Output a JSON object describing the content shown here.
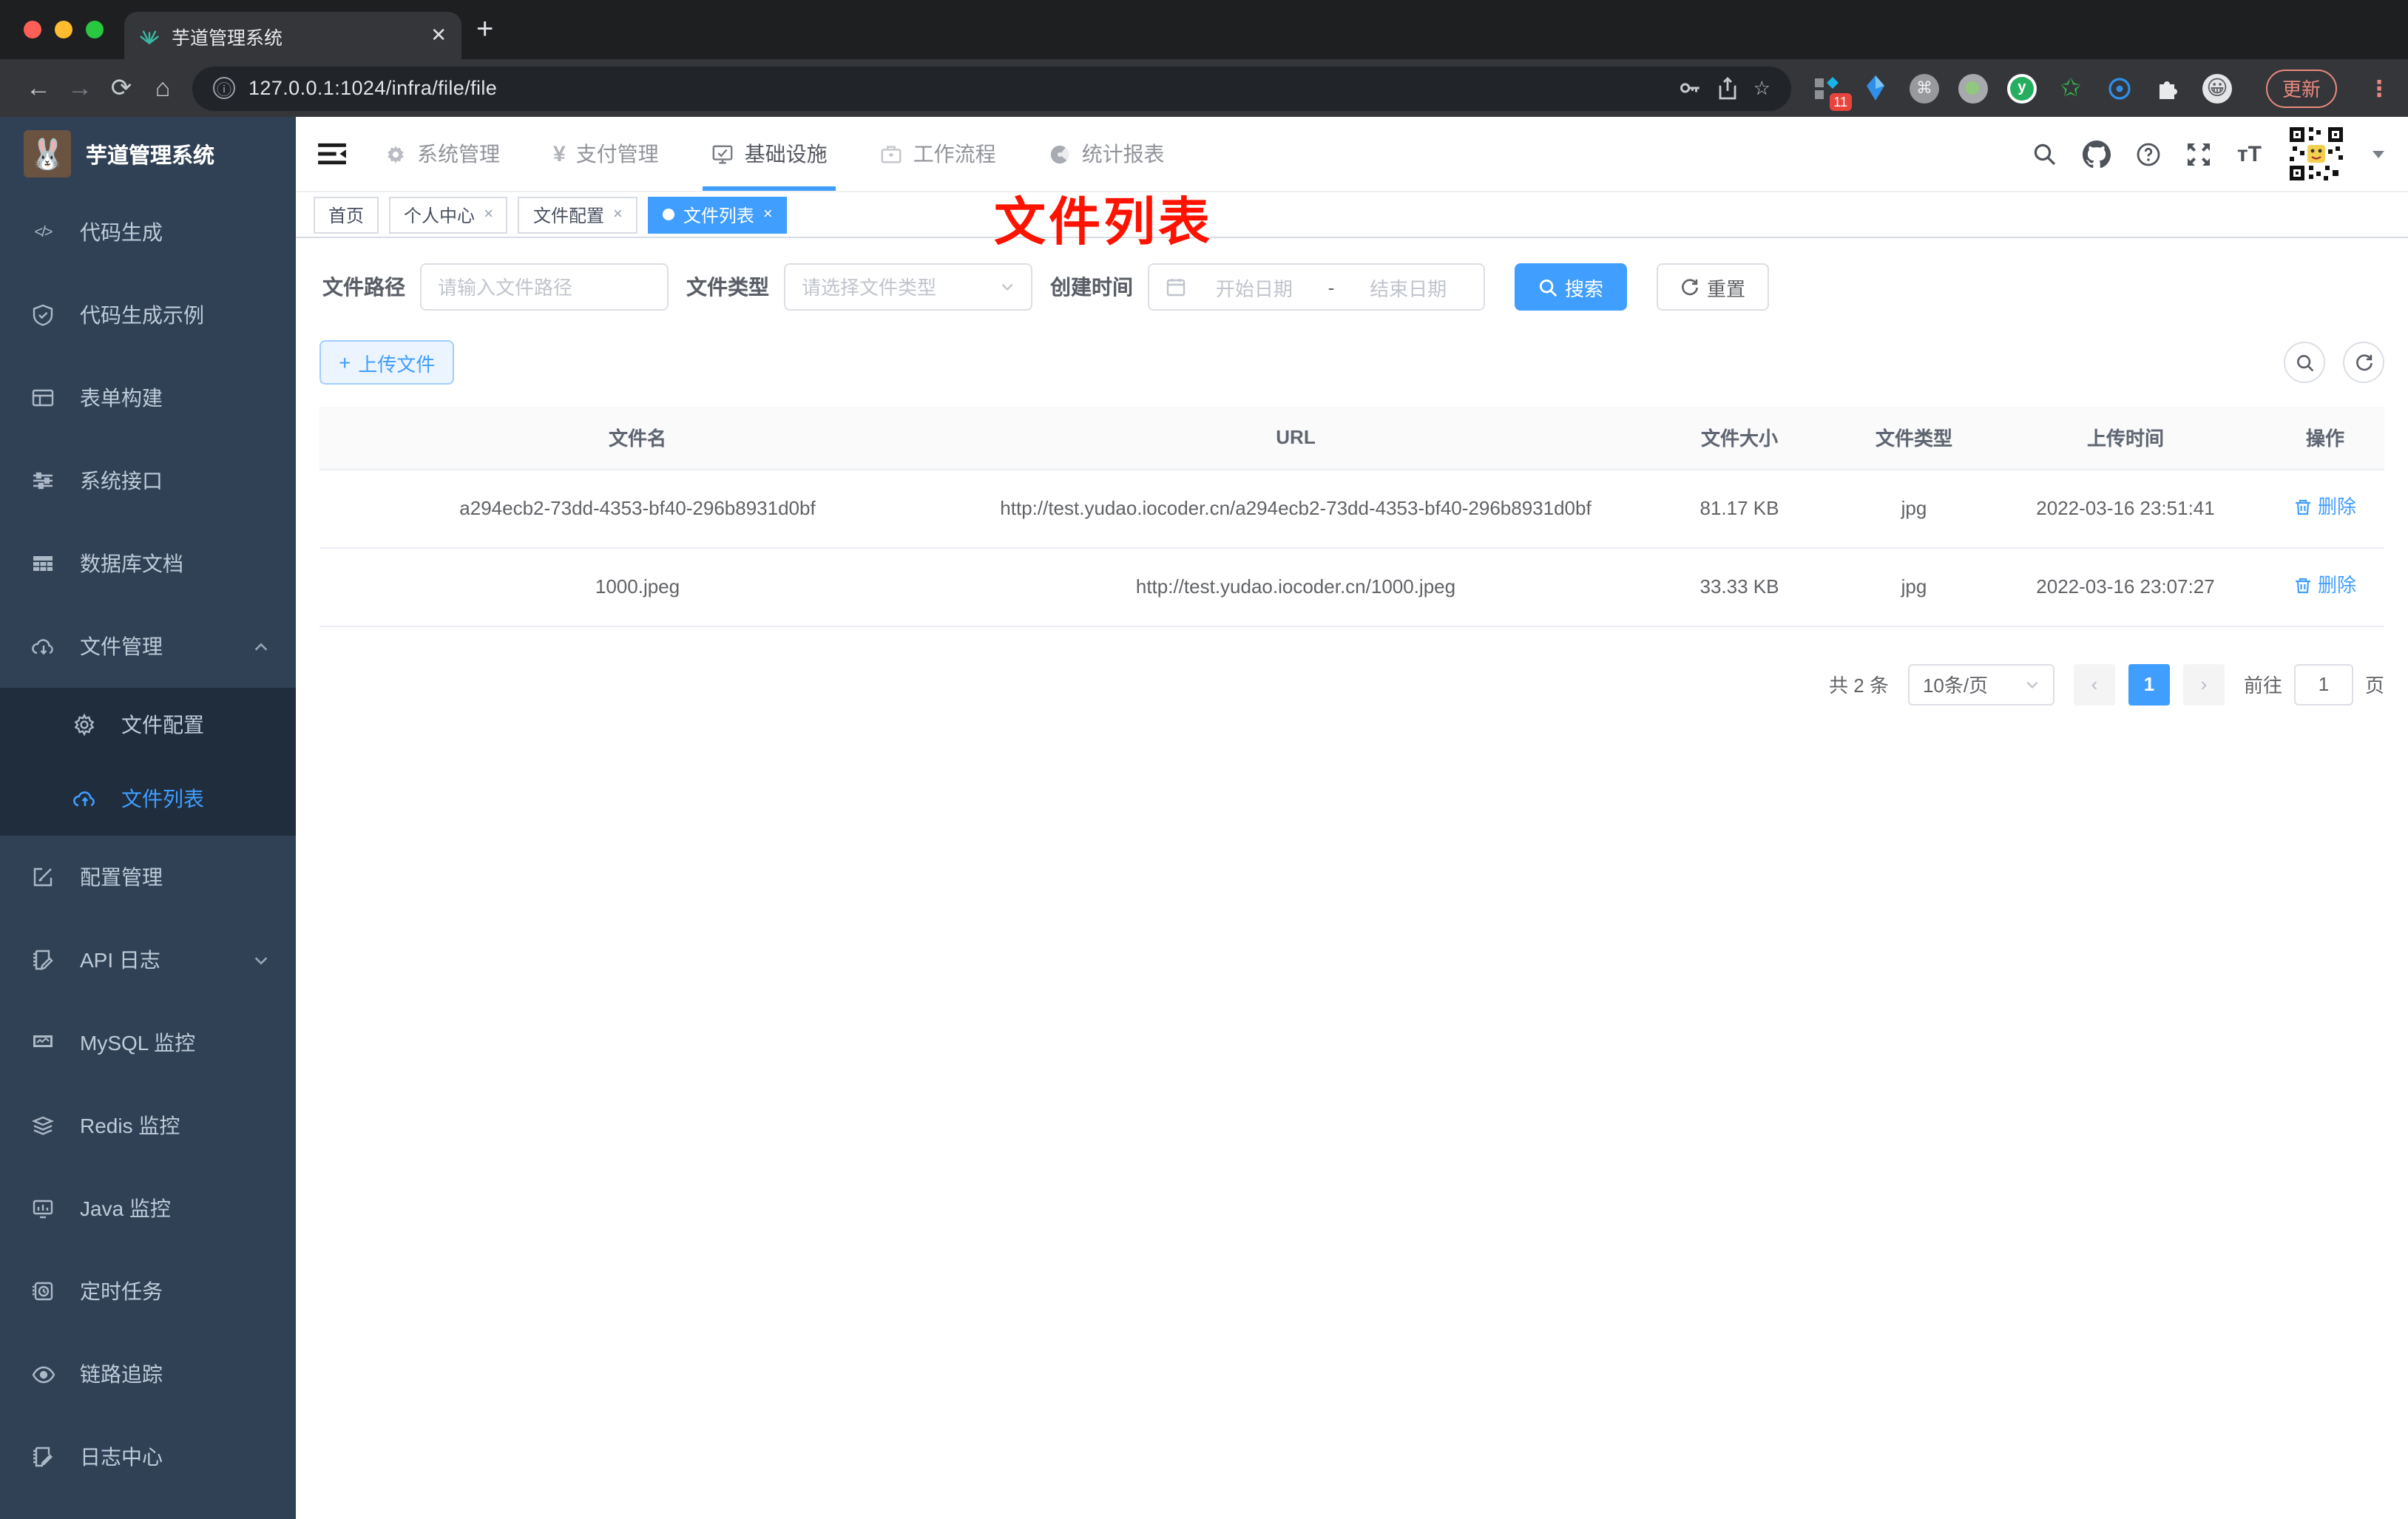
{
  "browser": {
    "tab_title": "芋道管理系统",
    "close_glyph": "✕",
    "new_tab_glyph": "+",
    "url": "127.0.0.1:1024/infra/file/file",
    "extension_badge": "11",
    "cmd_glyph": "⌘",
    "y_glyph": "y",
    "star_glyph": "✩",
    "emoji_glyph": "😀",
    "update_label": "更新",
    "dots_glyph": "⋮"
  },
  "sidebar": {
    "logo_title": "芋道管理系统",
    "logo_emoji": "🐰",
    "items": [
      {
        "label": "代码生成"
      },
      {
        "label": "代码生成示例"
      },
      {
        "label": "表单构建"
      },
      {
        "label": "系统接口"
      },
      {
        "label": "数据库文档"
      },
      {
        "label": "文件管理"
      },
      {
        "label": "文件配置"
      },
      {
        "label": "文件列表"
      },
      {
        "label": "配置管理"
      },
      {
        "label": "API 日志"
      },
      {
        "label": "MySQL 监控"
      },
      {
        "label": "Redis 监控"
      },
      {
        "label": "Java 监控"
      },
      {
        "label": "定时任务"
      },
      {
        "label": "链路追踪"
      },
      {
        "label": "日志中心"
      }
    ],
    "code_glyph": "</>"
  },
  "topnav": {
    "items": [
      {
        "label": "系统管理"
      },
      {
        "label": "支付管理",
        "glyph": "¥"
      },
      {
        "label": "基础设施"
      },
      {
        "label": "工作流程"
      },
      {
        "label": "统计报表"
      }
    ],
    "font_size_glyph": "тT"
  },
  "tags": {
    "close_glyph": "×",
    "items": [
      {
        "label": "首页"
      },
      {
        "label": "个人中心"
      },
      {
        "label": "文件配置"
      },
      {
        "label": "文件列表"
      }
    ]
  },
  "annotation": {
    "text": "文件列表"
  },
  "filter": {
    "path_label": "文件路径",
    "path_placeholder": "请输入文件路径",
    "type_label": "文件类型",
    "type_placeholder": "请选择文件类型",
    "date_label": "创建时间",
    "date_start_placeholder": "开始日期",
    "date_separator": "-",
    "date_end_placeholder": "结束日期",
    "search_label": "搜索",
    "reset_label": "重置"
  },
  "toolbar": {
    "upload_label": "上传文件",
    "plus_glyph": "+"
  },
  "table": {
    "columns": [
      "文件名",
      "URL",
      "文件大小",
      "文件类型",
      "上传时间",
      "操作"
    ],
    "rows": [
      {
        "name": "a294ecb2-73dd-4353-bf40-296b8931d0bf",
        "url": "http://test.yudao.iocoder.cn/a294ecb2-73dd-4353-bf40-296b8931d0bf",
        "size": "81.17 KB",
        "type": "jpg",
        "time": "2022-03-16 23:51:41",
        "action": "删除"
      },
      {
        "name": "1000.jpeg",
        "url": "http://test.yudao.iocoder.cn/1000.jpeg",
        "size": "33.33 KB",
        "type": "jpg",
        "time": "2022-03-16 23:07:27",
        "action": "删除"
      }
    ]
  },
  "pagination": {
    "total": "共 2 条",
    "page_size": "10条/页",
    "prev_glyph": "‹",
    "next_glyph": "›",
    "current_page": "1",
    "goto_label": "前往",
    "goto_value": "1",
    "page_unit": "页"
  },
  "colors": {
    "accent": "#409eff",
    "sidebar_bg": "#304156",
    "submenu_bg": "#1f2d3d",
    "annotation_red": "#ff1200",
    "tag_active": "#409eff"
  }
}
